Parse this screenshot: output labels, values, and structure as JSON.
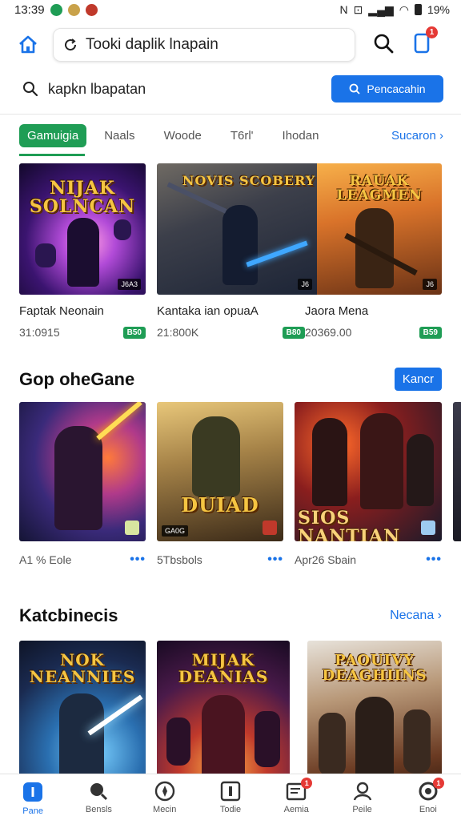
{
  "status_bar": {
    "time": "13:39",
    "battery": "19%"
  },
  "top_bar": {
    "url_text": "Tooki daplik lnapain",
    "notification_count": "1"
  },
  "search": {
    "query": "kapkn lbapatan",
    "button_label": "Pencacahin"
  },
  "tabs": {
    "items": [
      "Gamuigia",
      "Naals",
      "Woode",
      "T6rl'",
      "Ihodan"
    ],
    "more": "Sucaron ›"
  },
  "featured": [
    {
      "art_title": "NIJAK SOLNCAN",
      "tag": "J6A3",
      "name": "Faptak Neonain",
      "meta": "31:0915",
      "badge": "B50"
    },
    {
      "art_title": "NOVIS SCOBERY",
      "tag": "J6",
      "name": "Kantaka ian opuaA",
      "meta": "21:800K",
      "badge": "B80"
    },
    {
      "art_title": "RAUAK LEAGMEN",
      "tag": "J6",
      "name": "Jaora Mena",
      "meta": "20369.00",
      "badge": "B59"
    }
  ],
  "section1": {
    "title": "Gop oheGane",
    "button": "Kancr",
    "cards": [
      {
        "art_title": "",
        "meta": "A1 % Eole",
        "dots": "•••"
      },
      {
        "art_title": "DUIAD",
        "tag": "GA0G",
        "meta": "5Tbsbols",
        "dots": "•••"
      },
      {
        "art_title": "SIOS NANTIAN",
        "meta": "Apr26 Sbain",
        "dots": "•••"
      }
    ]
  },
  "section2": {
    "title": "Katcbinecis",
    "link": "Necana ›",
    "cards": [
      {
        "art_title": "NOK NEANNIES"
      },
      {
        "art_title": "MIJAK DEANIAS"
      },
      {
        "art_title": "PAOUIVY DEAGHIINS"
      }
    ]
  },
  "bottom_nav": [
    {
      "label": "Pane",
      "icon": "home-icon",
      "active": true
    },
    {
      "label": "Bensls",
      "icon": "search-icon"
    },
    {
      "label": "Mecin",
      "icon": "compass-icon"
    },
    {
      "label": "Todie",
      "icon": "library-icon"
    },
    {
      "label": "Aemia",
      "icon": "news-icon",
      "badge": "1"
    },
    {
      "label": "Peile",
      "icon": "profile-icon"
    },
    {
      "label": "Enoi",
      "icon": "settings-icon",
      "badge": "1"
    }
  ]
}
